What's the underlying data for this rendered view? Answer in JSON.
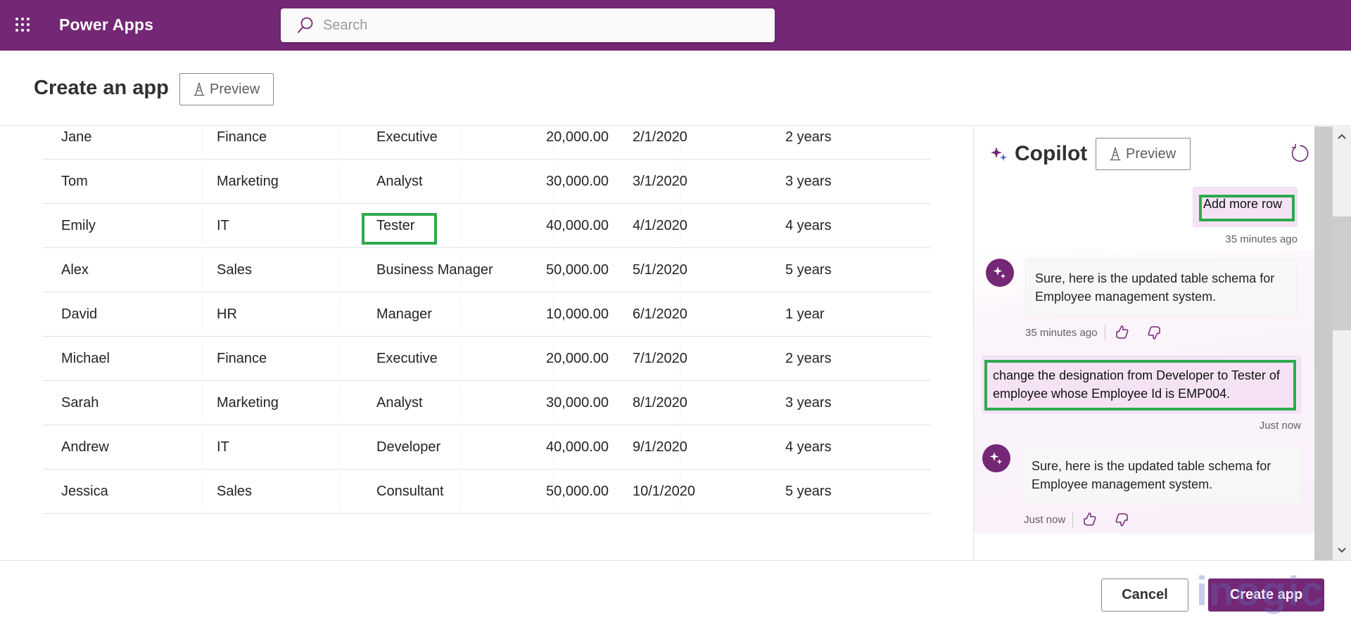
{
  "header": {
    "app_name": "Power Apps",
    "search_placeholder": "Search",
    "brand_color": "#742774"
  },
  "page": {
    "title": "Create an app",
    "preview_label": "Preview"
  },
  "table": {
    "rows": [
      {
        "name": "Jane",
        "department": "Finance",
        "designation": "Executive",
        "salary": "20,000.00",
        "date": "2/1/2020",
        "experience": "2 years"
      },
      {
        "name": "Tom",
        "department": "Marketing",
        "designation": "Analyst",
        "salary": "30,000.00",
        "date": "3/1/2020",
        "experience": "3 years"
      },
      {
        "name": "Emily",
        "department": "IT",
        "designation": "Tester",
        "salary": "40,000.00",
        "date": "4/1/2020",
        "experience": "4 years",
        "highlighted": true
      },
      {
        "name": "Alex",
        "department": "Sales",
        "designation": "Business Manager",
        "salary": "50,000.00",
        "date": "5/1/2020",
        "experience": "5 years"
      },
      {
        "name": "David",
        "department": "HR",
        "designation": "Manager",
        "salary": "10,000.00",
        "date": "6/1/2020",
        "experience": "1 year"
      },
      {
        "name": "Michael",
        "department": "Finance",
        "designation": "Executive",
        "salary": "20,000.00",
        "date": "7/1/2020",
        "experience": "2 years"
      },
      {
        "name": "Sarah",
        "department": "Marketing",
        "designation": "Analyst",
        "salary": "30,000.00",
        "date": "8/1/2020",
        "experience": "3 years"
      },
      {
        "name": "Andrew",
        "department": "IT",
        "designation": "Developer",
        "salary": "40,000.00",
        "date": "9/1/2020",
        "experience": "4 years"
      },
      {
        "name": "Jessica",
        "department": "Sales",
        "designation": "Consultant",
        "salary": "50,000.00",
        "date": "10/1/2020",
        "experience": "5 years"
      }
    ]
  },
  "copilot": {
    "title": "Copilot",
    "preview_label": "Preview",
    "messages": [
      {
        "role": "user",
        "text": "Add more row",
        "timestamp": "35 minutes ago"
      },
      {
        "role": "bot",
        "text": "Sure, here is the updated table schema for Employee management system.",
        "timestamp": "35 minutes ago"
      },
      {
        "role": "user",
        "text": "change the designation from Developer to Tester of employee whose Employee Id is EMP004.",
        "timestamp": "Just now"
      },
      {
        "role": "bot",
        "text": "Sure, here is the updated table schema for Employee management system.",
        "timestamp": "Just now"
      }
    ]
  },
  "footer": {
    "cancel_label": "Cancel",
    "create_label": "Create app",
    "watermark": "inogic"
  },
  "colors": {
    "brand": "#742774",
    "highlight": "#2eaa4f",
    "user_bubble": "#f5e3f5"
  }
}
